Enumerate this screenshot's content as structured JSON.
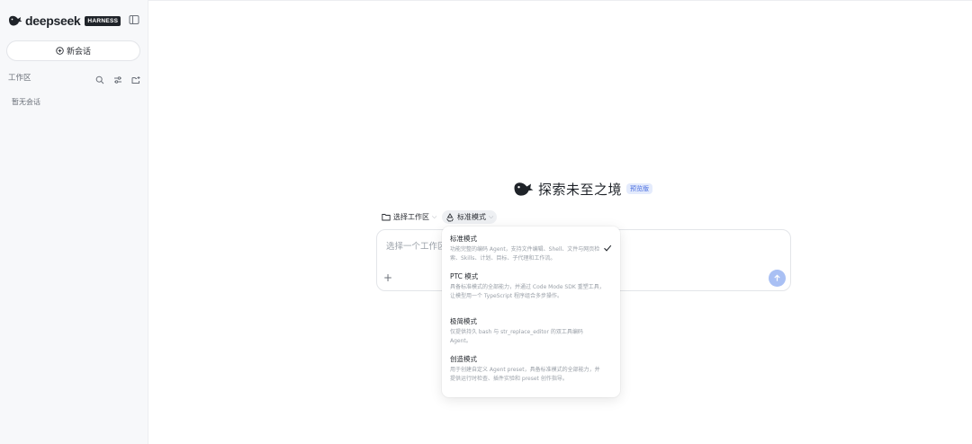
{
  "sidebar": {
    "brand_name": "deepseek",
    "brand_badge": "HARNESS",
    "new_chat_label": "新会话",
    "workspace_label": "工作区",
    "empty_label": "暂无会话"
  },
  "main": {
    "hero_title": "探索未至之境",
    "hero_badge": "预览版",
    "workspace_picker_label": "选择工作区",
    "mode_picker_label": "标准模式",
    "composer_placeholder": "选择一个工作区"
  },
  "mode_menu": {
    "selected_index": 0,
    "items": [
      {
        "title": "标准模式",
        "description": "功能完整的编码 Agent，支持文件编辑、Shell、文件与网页检索、Skills、计划、目标、子代理和工作流。"
      },
      {
        "title": "PTC 模式",
        "description": "具备标准模式的全部能力，并通过 Code Mode SDK 重塑工具，让模型用一个 TypeScript 程序组合多步操作。"
      },
      {
        "title": "极简模式",
        "description": "仅提供持久 bash 与 str_replace_editor 的双工具编码 Agent。"
      },
      {
        "title": "创造模式",
        "description": "用于创建自定义 Agent preset，具备标准模式的全部能力，并提供运行时检查、插件实验和 preset 创作指导。"
      }
    ]
  },
  "colors": {
    "accent": "#4a6ee0",
    "send_button": "#a9c0f4",
    "badge_bg": "#e4ebfc"
  },
  "icons": [
    "whale-logo-icon",
    "sidebar-toggle-icon",
    "plus-circle-icon",
    "search-icon",
    "sliders-icon",
    "new-folder-icon",
    "folder-icon",
    "recycle-mode-icon",
    "chevron-down-icon",
    "plus-icon",
    "arrow-up-icon",
    "check-icon"
  ]
}
